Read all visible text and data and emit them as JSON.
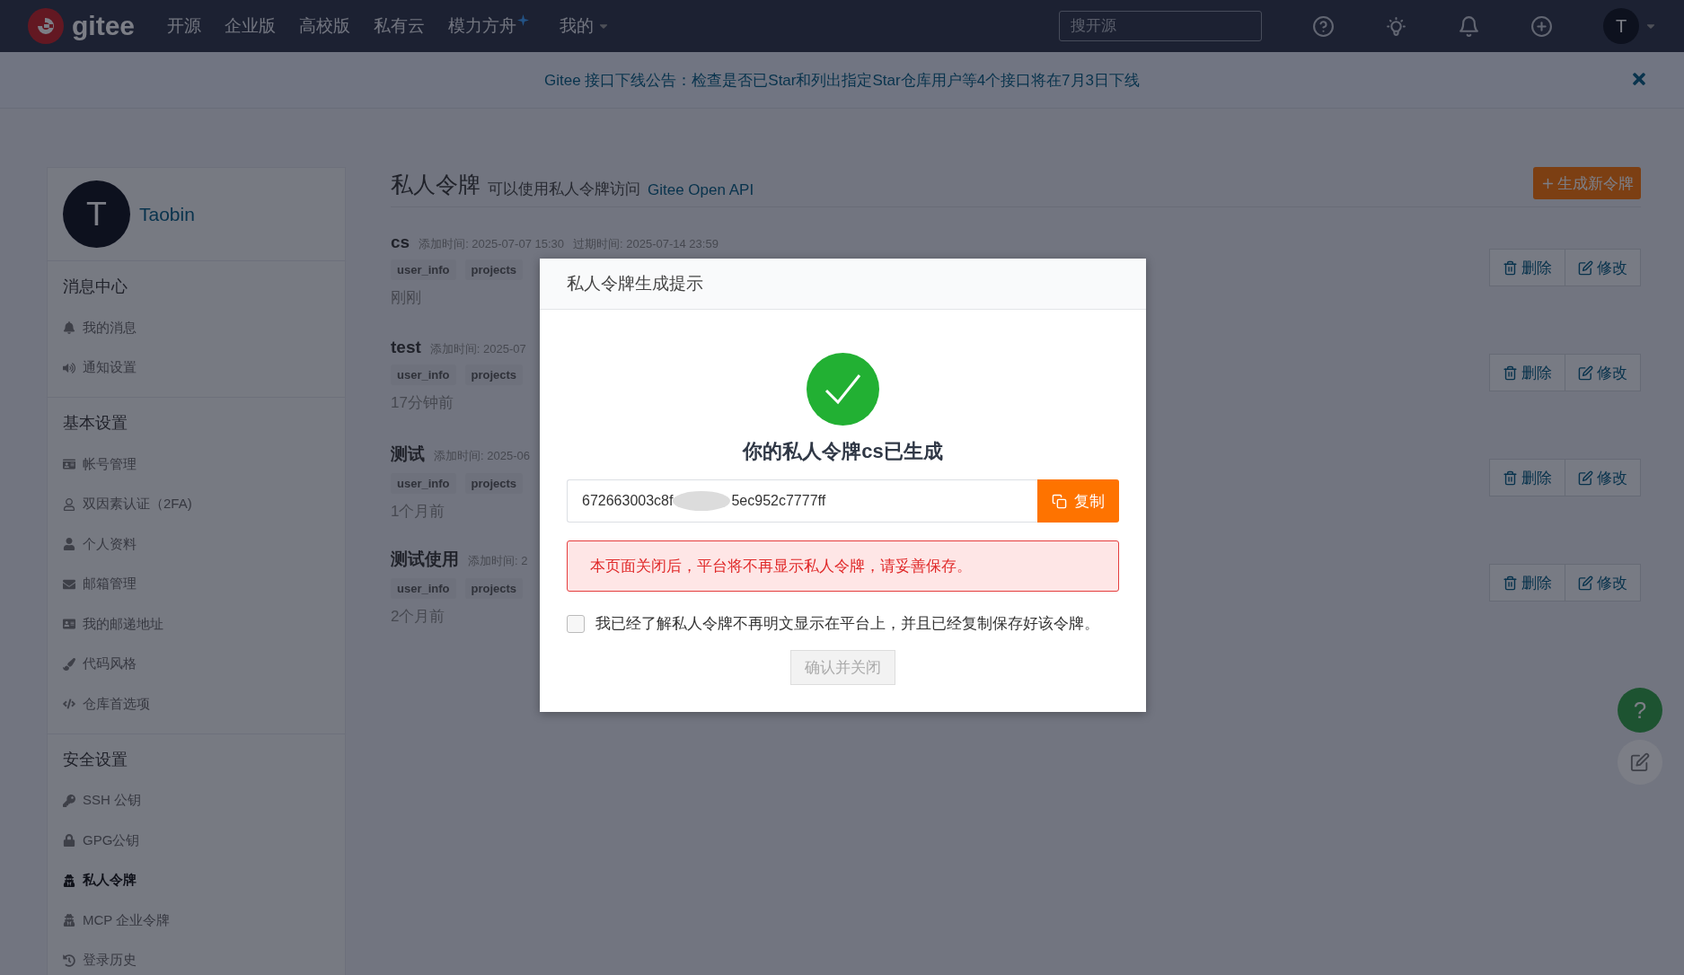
{
  "nav": {
    "logo": "gitee",
    "items": [
      {
        "label": "开源",
        "badge": false
      },
      {
        "label": "企业版",
        "badge": false
      },
      {
        "label": "高校版",
        "badge": false
      },
      {
        "label": "私有云",
        "badge": false
      },
      {
        "label": "模力方舟",
        "badge": true
      }
    ],
    "mine": "我的",
    "search": {
      "placeholder": "搜开源"
    },
    "avatar": "T"
  },
  "announcement": {
    "text": "Gitee 接口下线公告：检查是否已Star和列出指定Star仓库用户等4个接口将在7月3日下线"
  },
  "sidebar": {
    "avatar": "T",
    "user": "Taobin",
    "sections": [
      {
        "title": "消息中心",
        "items": [
          {
            "label": "我的消息",
            "selected": false
          },
          {
            "label": "通知设置",
            "selected": false
          }
        ]
      },
      {
        "title": "基本设置",
        "items": [
          {
            "label": "帐号管理",
            "selected": false
          },
          {
            "label": "双因素认证（2FA)",
            "selected": false
          },
          {
            "label": "个人资料",
            "selected": false
          },
          {
            "label": "邮箱管理",
            "selected": false
          },
          {
            "label": "我的邮递地址",
            "selected": false
          },
          {
            "label": "代码风格",
            "selected": false
          },
          {
            "label": "仓库首选项",
            "selected": false
          }
        ]
      },
      {
        "title": "安全设置",
        "items": [
          {
            "label": "SSH 公钥",
            "selected": false
          },
          {
            "label": "GPG公钥",
            "selected": false
          },
          {
            "label": "私人令牌",
            "selected": true
          },
          {
            "label": "MCP 企业令牌",
            "selected": false
          },
          {
            "label": "登录历史",
            "selected": false
          }
        ]
      }
    ]
  },
  "content": {
    "title": "私人令牌",
    "subtitle": "可以使用私人令牌访问",
    "link": "Gitee Open API",
    "new_button": "生成新令牌",
    "tokens": [
      {
        "name": "cs",
        "meta": [
          "添加时间: 2025-07-07 15:30",
          "过期时间: 2025-07-14 23:59"
        ],
        "tags": [
          "user_info",
          "projects"
        ],
        "ago": "刚刚",
        "delete": "删除",
        "edit": "修改"
      },
      {
        "name": "test",
        "meta": [
          "添加时间: 2025-07"
        ],
        "tags": [
          "user_info",
          "projects"
        ],
        "ago": "17分钟前",
        "delete": "删除",
        "edit": "修改"
      },
      {
        "name": "测试",
        "meta": [
          "添加时间: 2025-06"
        ],
        "tags": [
          "user_info",
          "projects"
        ],
        "ago": "1个月前",
        "delete": "删除",
        "edit": "修改"
      },
      {
        "name": "测试使用",
        "meta": [
          "添加时间: 2"
        ],
        "tags": [
          "user_info",
          "projects"
        ],
        "ago": "2个月前",
        "delete": "删除",
        "edit": "修改"
      }
    ]
  },
  "help": "?",
  "modal": {
    "title": "私人令牌生成提示",
    "heading": "你的私人令牌cs已生成",
    "token": {
      "start": "672663003c8f",
      "redacted": true,
      "end": "5ec952c7777ff"
    },
    "copy": "复制",
    "warning": "本页面关闭后，平台将不再显示私人令牌，请妥善保存。",
    "ack": {
      "label": "我已经了解私人令牌不再明文显示在平台上，并且已经复制保存好该令牌。",
      "checked": false
    },
    "confirm": {
      "label": "确认并关闭",
      "disabled": true
    }
  }
}
